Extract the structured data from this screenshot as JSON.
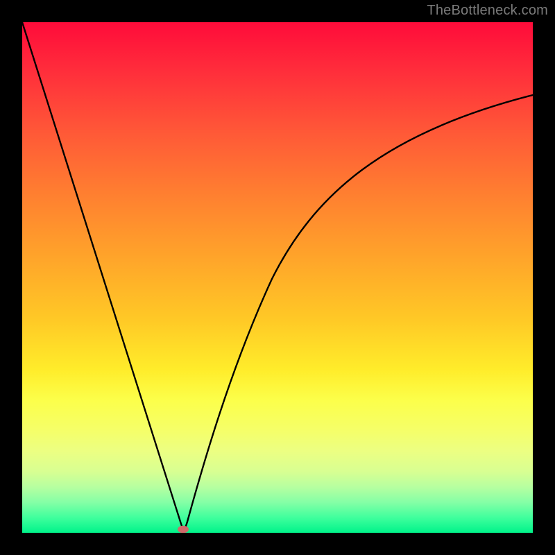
{
  "watermark": "TheBottleneck.com",
  "chart_data": {
    "type": "line",
    "title": "",
    "xlabel": "",
    "ylabel": "",
    "xlim": [
      0,
      100
    ],
    "ylim": [
      0,
      100
    ],
    "grid": false,
    "legend": false,
    "annotations": [],
    "series": [
      {
        "name": "bottleneck-curve",
        "color": "#000000",
        "x": [
          0,
          2,
          4,
          6,
          8,
          10,
          12,
          14,
          16,
          18,
          20,
          22,
          24,
          26,
          28,
          30,
          31.5,
          33,
          35,
          38,
          42,
          46,
          50,
          55,
          60,
          66,
          72,
          78,
          84,
          90,
          96,
          100
        ],
        "y": [
          100,
          93,
          87,
          80,
          74,
          67,
          61,
          54,
          48,
          41,
          35,
          28,
          22,
          15,
          9,
          3,
          0,
          3,
          9,
          18,
          28,
          37,
          45,
          53,
          59,
          65,
          70,
          74,
          78,
          81,
          84,
          86
        ]
      }
    ],
    "markers": [
      {
        "name": "valley-marker",
        "shape": "ellipse",
        "x": 31.5,
        "y": 0,
        "rx": 1.0,
        "ry": 0.55,
        "color": "#cf6a6a"
      }
    ],
    "background": {
      "type": "vertical-gradient",
      "stops": [
        {
          "offset": 0,
          "color": "#ff0b3a"
        },
        {
          "offset": 50,
          "color": "#ffb627"
        },
        {
          "offset": 78,
          "color": "#feff55"
        },
        {
          "offset": 100,
          "color": "#00f38a"
        }
      ]
    }
  }
}
